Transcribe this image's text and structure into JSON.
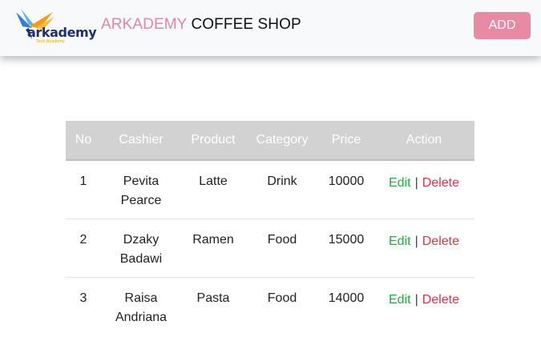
{
  "header": {
    "logo": {
      "wordmark": "arkademy",
      "tagline": "Tech Academy",
      "colors": {
        "wordmark": "#1f2f6e",
        "tagline": "#f2a500",
        "bird_blue": "#2f7fd2",
        "bird_orange": "#f29b1f"
      }
    },
    "brand_part1": "ARKADEMY",
    "brand_part2": "COFFEE SHOP",
    "add_label": "ADD"
  },
  "table": {
    "columns": [
      "No",
      "Cashier",
      "Product",
      "Category",
      "Price",
      "Action"
    ],
    "rows": [
      {
        "no": "1",
        "cashier_line1": "Pevita",
        "cashier_line2": "Pearce",
        "product": "Latte",
        "category": "Drink",
        "price": "10000",
        "edit": "Edit",
        "separator": "|",
        "delete": "Delete"
      },
      {
        "no": "2",
        "cashier_line1": "Dzaky",
        "cashier_line2": "Badawi",
        "product": "Ramen",
        "category": "Food",
        "price": "15000",
        "edit": "Edit",
        "separator": "|",
        "delete": "Delete"
      },
      {
        "no": "3",
        "cashier_line1": "Raisa",
        "cashier_line2": "Andriana",
        "product": "Pasta",
        "category": "Food",
        "price": "14000",
        "edit": "Edit",
        "separator": "|",
        "delete": "Delete"
      }
    ]
  },
  "colors": {
    "accent_pink": "#e98aa5",
    "header_bg": "#f8f9fa",
    "table_header_bg": "#d2d2d2",
    "edit_green": "#28a745",
    "delete_red": "#dc3545"
  }
}
